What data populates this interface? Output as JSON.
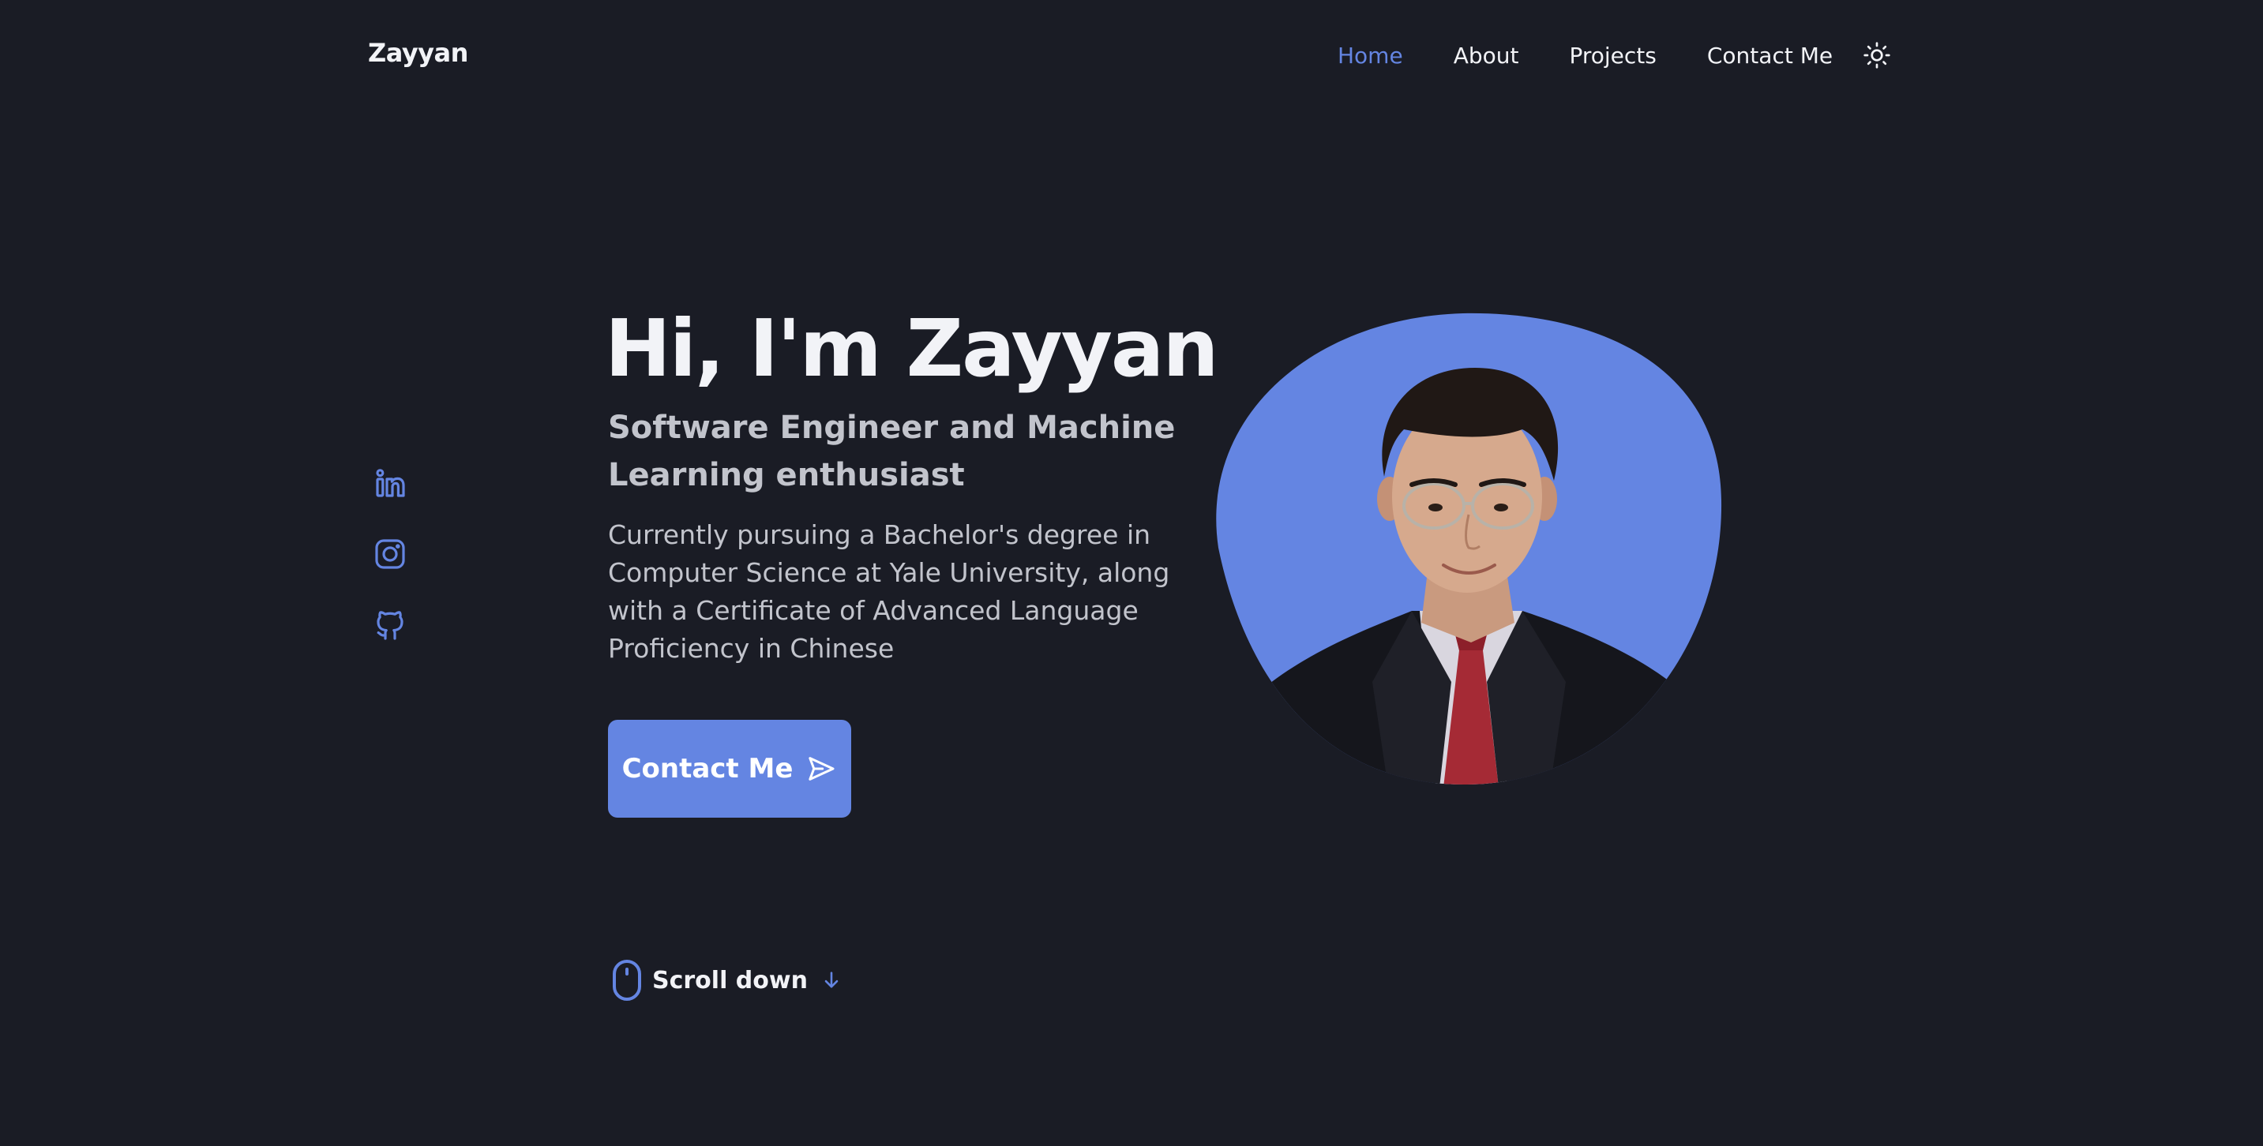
{
  "header": {
    "logo": "Zayyan",
    "nav": {
      "home": "Home",
      "about": "About",
      "projects": "Projects",
      "contact": "Contact Me"
    },
    "active_item": "Home",
    "theme_toggle_icon": "sun-icon"
  },
  "social": {
    "icons": [
      "linkedin-icon",
      "instagram-icon",
      "github-icon"
    ]
  },
  "hero": {
    "title": "Hi, I'm Zayyan",
    "subtitle": "Software Engineer and Machine Learning enthusiast",
    "description": "Currently pursuing a Bachelor's degree in Computer Science at Yale University, along with a Certificate of Advanced Language Proficiency in Chinese",
    "button_label": "Contact Me",
    "button_icon": "send-icon"
  },
  "scroll": {
    "label": "Scroll down",
    "icons": [
      "mouse-icon",
      "arrow-down-icon"
    ]
  },
  "colors": {
    "background": "#1a1c25",
    "accent": "#6485e2",
    "text": "#f2f3f7",
    "muted_text": "#c2c4cc"
  }
}
